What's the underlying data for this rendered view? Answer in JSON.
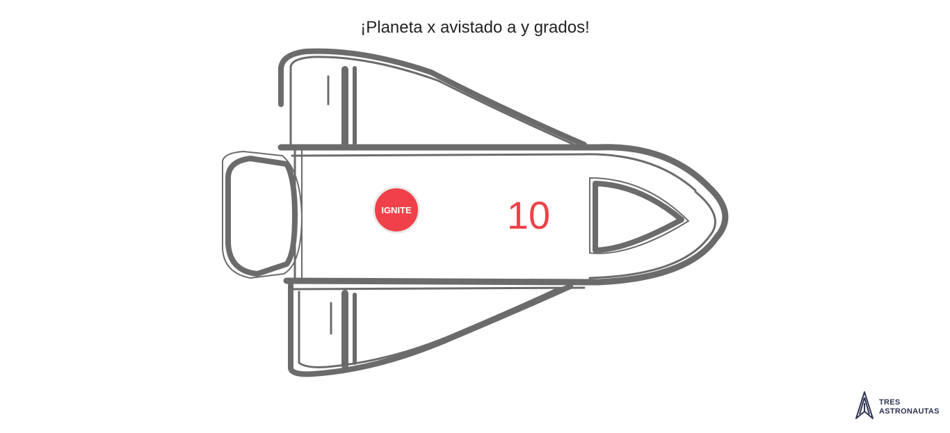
{
  "headline": "¡Planeta x avistado a y grados!",
  "ignite_button": {
    "label": "IGNITE"
  },
  "countdown": {
    "value": "10"
  },
  "brand": {
    "line1": "TRES",
    "line2": "ASTRONAUTAS"
  },
  "colors": {
    "ship_stroke": "#6b6b6b",
    "accent_red": "#f0414a",
    "brand_navy": "#2d3350"
  },
  "icons": {
    "ship": "rocket-ship-illustration",
    "logo": "rocket-a-logo-icon"
  }
}
